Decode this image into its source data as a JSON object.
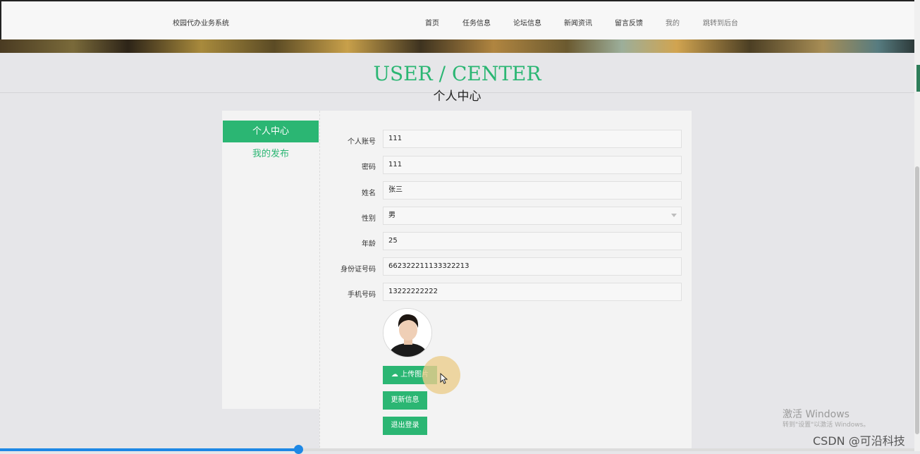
{
  "app": {
    "title": "校园代办业务系统"
  },
  "nav": {
    "items": [
      {
        "label": "首页"
      },
      {
        "label": "任务信息"
      },
      {
        "label": "论坛信息"
      },
      {
        "label": "新闻资讯"
      },
      {
        "label": "留言反馈"
      },
      {
        "label": "我的"
      },
      {
        "label": "跳转到后台"
      }
    ]
  },
  "header": {
    "title_en": "USER / CENTER",
    "title_cn": "个人中心"
  },
  "sidebar": {
    "items": [
      {
        "label": "个人中心",
        "active": true
      },
      {
        "label": "我的发布",
        "active": false
      }
    ]
  },
  "form": {
    "fields": [
      {
        "label": "个人账号",
        "value": "111"
      },
      {
        "label": "密码",
        "value": "111"
      },
      {
        "label": "姓名",
        "value": "张三"
      },
      {
        "label": "性别",
        "value": "男"
      },
      {
        "label": "年龄",
        "value": "25"
      },
      {
        "label": "身份证号码",
        "value": "662322211133322213"
      },
      {
        "label": "手机号码",
        "value": "13222222222"
      }
    ],
    "upload_label": "上传图片",
    "update_label": "更新信息",
    "logout_label": "退出登录"
  },
  "overlay": {
    "watermark": "激活 Windows",
    "watermark_sub": "转到\"设置\"以激活 Windows。",
    "csdn": "CSDN @可沿科技"
  },
  "colors": {
    "accent": "#2bb673",
    "progress": "#1e88e5"
  }
}
